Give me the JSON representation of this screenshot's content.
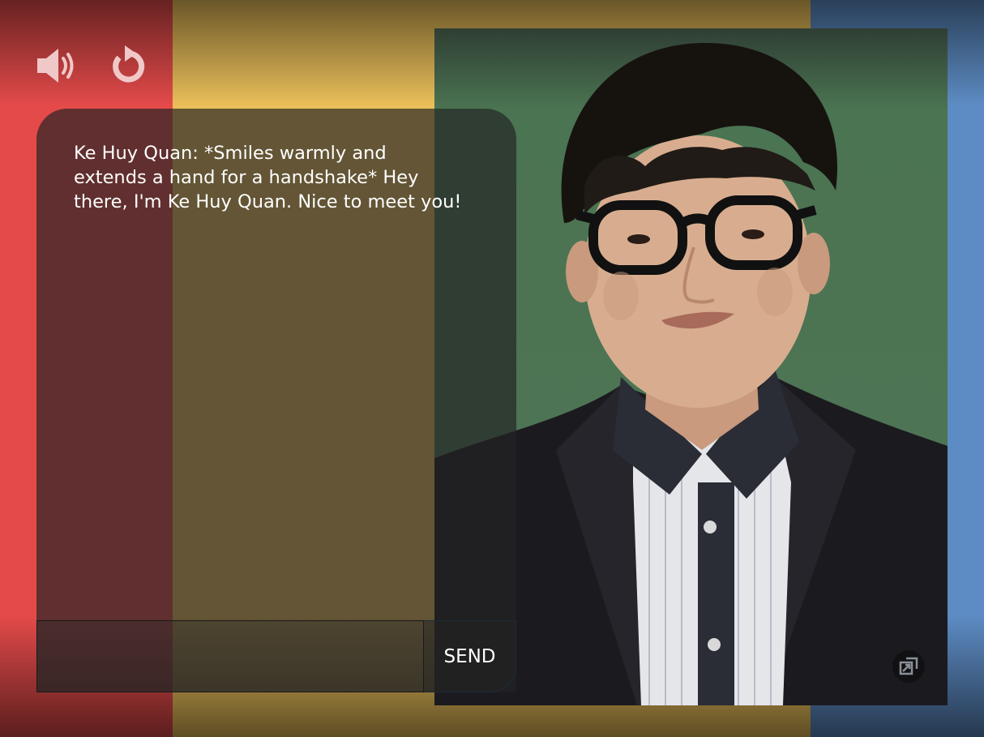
{
  "colors": {
    "stripe_red": "#e44a4a",
    "stripe_yellow": "#eabf5a",
    "stripe_blue": "#5d8cc4",
    "portrait_bg": "#4f7355"
  },
  "toolbar": {
    "sound_icon": "speaker-icon",
    "reset_icon": "reload-icon"
  },
  "chat": {
    "messages": [
      {
        "text": "Ke Huy Quan: *Smiles warmly and extends a hand for a handshake* Hey there, I'm Ke Huy Quan. Nice to meet you!"
      }
    ],
    "input": {
      "value": "",
      "placeholder": ""
    },
    "send_label": "SEND"
  },
  "portrait": {
    "expand_icon": "expand-icon"
  }
}
